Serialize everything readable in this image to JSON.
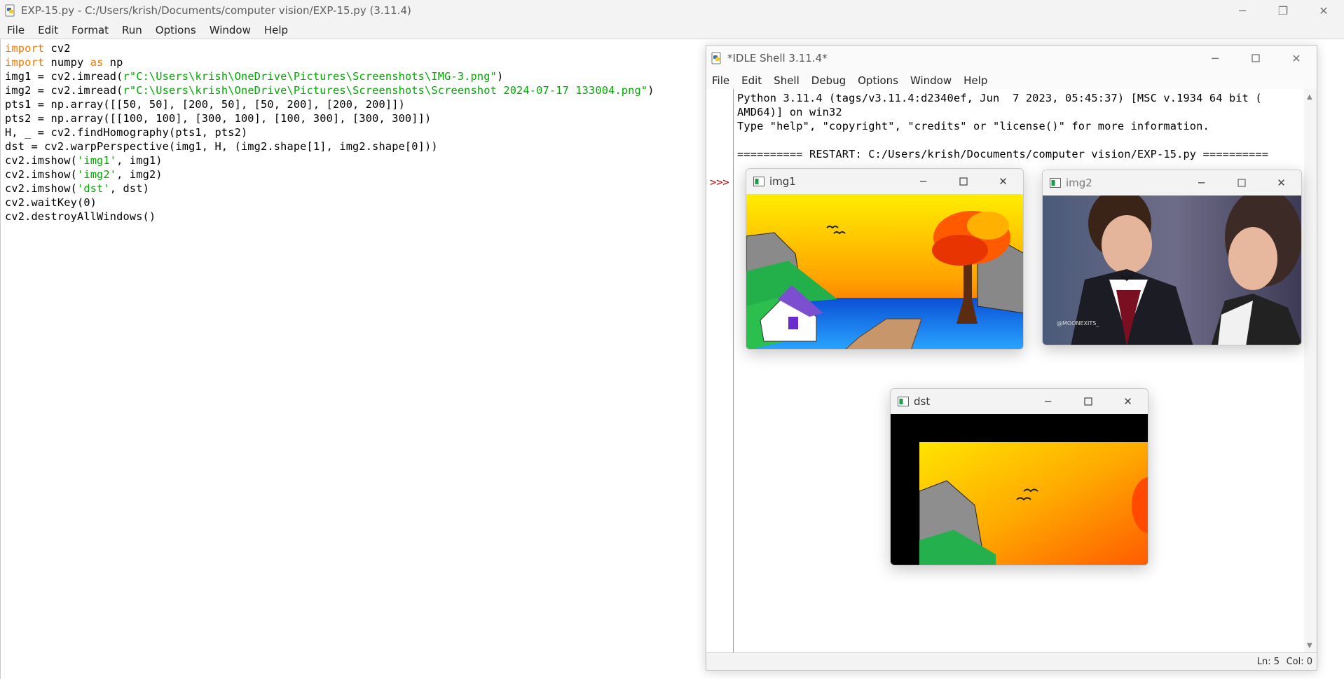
{
  "editor": {
    "title": "EXP-15.py - C:/Users/krish/Documents/computer vision/EXP-15.py (3.11.4)",
    "menu": [
      "File",
      "Edit",
      "Format",
      "Run",
      "Options",
      "Window",
      "Help"
    ],
    "window_controls": {
      "minimize": "─",
      "restore": "❐",
      "close": "✕"
    }
  },
  "code": {
    "line1": {
      "kw": "import",
      "rest": " cv2"
    },
    "line2": {
      "kw1": "import",
      "mid": " numpy ",
      "kw2": "as",
      "rest": " np"
    },
    "line3": {
      "pre": "img1 = cv2.imread(",
      "str": "r\"C:\\Users\\krish\\OneDrive\\Pictures\\Screenshots\\IMG-3.png\"",
      "post": ")"
    },
    "line4": {
      "pre": "img2 = cv2.imread(",
      "str": "r\"C:\\Users\\krish\\OneDrive\\Pictures\\Screenshots\\Screenshot 2024-07-17 133004.png\"",
      "post": ")"
    },
    "line5": "pts1 = np.array([[50, 50], [200, 50], [50, 200], [200, 200]])",
    "line6": "pts2 = np.array([[100, 100], [300, 100], [100, 300], [300, 300]])",
    "line7": "H, _ = cv2.findHomography(pts1, pts2)",
    "line8": "dst = cv2.warpPerspective(img1, H, (img2.shape[1], img2.shape[0]))",
    "line9": {
      "pre": "cv2.imshow(",
      "str": "'img1'",
      "post": ", img1)"
    },
    "line10": {
      "pre": "cv2.imshow(",
      "str": "'img2'",
      "post": ", img2)"
    },
    "line11": {
      "pre": "cv2.imshow(",
      "str": "'dst'",
      "post": ", dst)"
    },
    "line12": "cv2.waitKey(0)",
    "line13": "cv2.destroyAllWindows()"
  },
  "shell": {
    "title": "*IDLE Shell 3.11.4*",
    "menu": [
      "File",
      "Edit",
      "Shell",
      "Debug",
      "Options",
      "Window",
      "Help"
    ],
    "prompt": ">>>",
    "lines": [
      "Python 3.11.4 (tags/v3.11.4:d2340ef, Jun  7 2023, 05:45:37) [MSC v.1934 64 bit (",
      "AMD64)] on win32",
      "Type \"help\", \"copyright\", \"credits\" or \"license()\" for more information.",
      "",
      "========== RESTART: C:/Users/krish/Documents/computer vision/EXP-15.py =========="
    ],
    "status": {
      "ln": "Ln: 5",
      "col": "Col: 0"
    }
  },
  "cv_windows": {
    "img1": {
      "title": "img1"
    },
    "img2": {
      "title": "img2",
      "watermark": "@MOONEXITS_"
    },
    "dst": {
      "title": "dst"
    }
  },
  "colors": {
    "keyword": "#ff7700",
    "string": "#00aa00",
    "prompt": "#c00000",
    "chrome": "#f3f3f3"
  }
}
